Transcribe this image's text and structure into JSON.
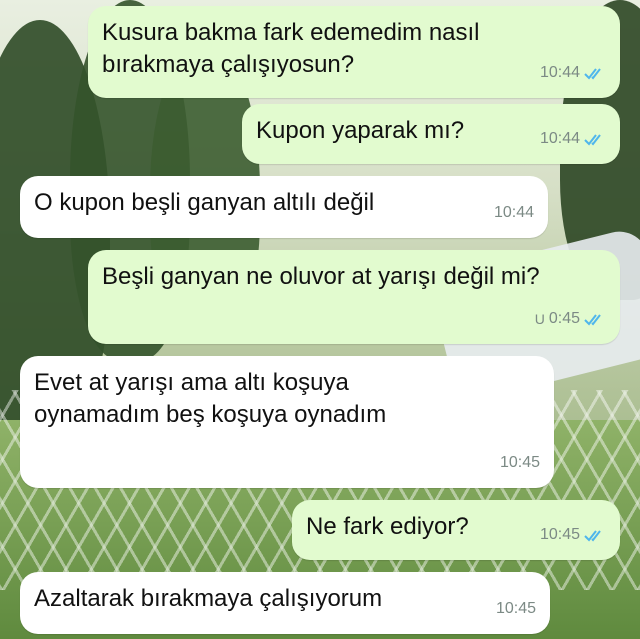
{
  "messages": [
    {
      "direction": "outgoing",
      "text": "Kusura bakma fark edemedim nasıl bırakmaya çalışıyosun?",
      "time": "10:44",
      "status": "read"
    },
    {
      "direction": "outgoing",
      "text": "Kupon yaparak mı?",
      "time": "10:44",
      "status": "read"
    },
    {
      "direction": "incoming",
      "text": "O kupon beşli ganyan altılı değil",
      "time": "10:44"
    },
    {
      "direction": "outgoing",
      "text": "Beşli ganyan ne oluvor at yarışı değil mi?",
      "time": "0:45",
      "status": "read",
      "prefix": "U"
    },
    {
      "direction": "incoming",
      "text": "Evet at yarışı ama altı koşuya oynamadım beş koşuya oynadım",
      "time": "10:45"
    },
    {
      "direction": "outgoing",
      "text": "Ne fark ediyor?",
      "time": "10:45",
      "status": "read"
    },
    {
      "direction": "incoming",
      "text": "Azaltarak bırakmaya çalışıyorum",
      "time": "10:45"
    }
  ],
  "colors": {
    "outgoing_bubble": "#e2fbcf",
    "incoming_bubble": "#ffffff",
    "read_ticks": "#4fb6ec",
    "timestamp": "#7c8a85"
  },
  "icons": {
    "read_receipt": "double-check-icon"
  }
}
